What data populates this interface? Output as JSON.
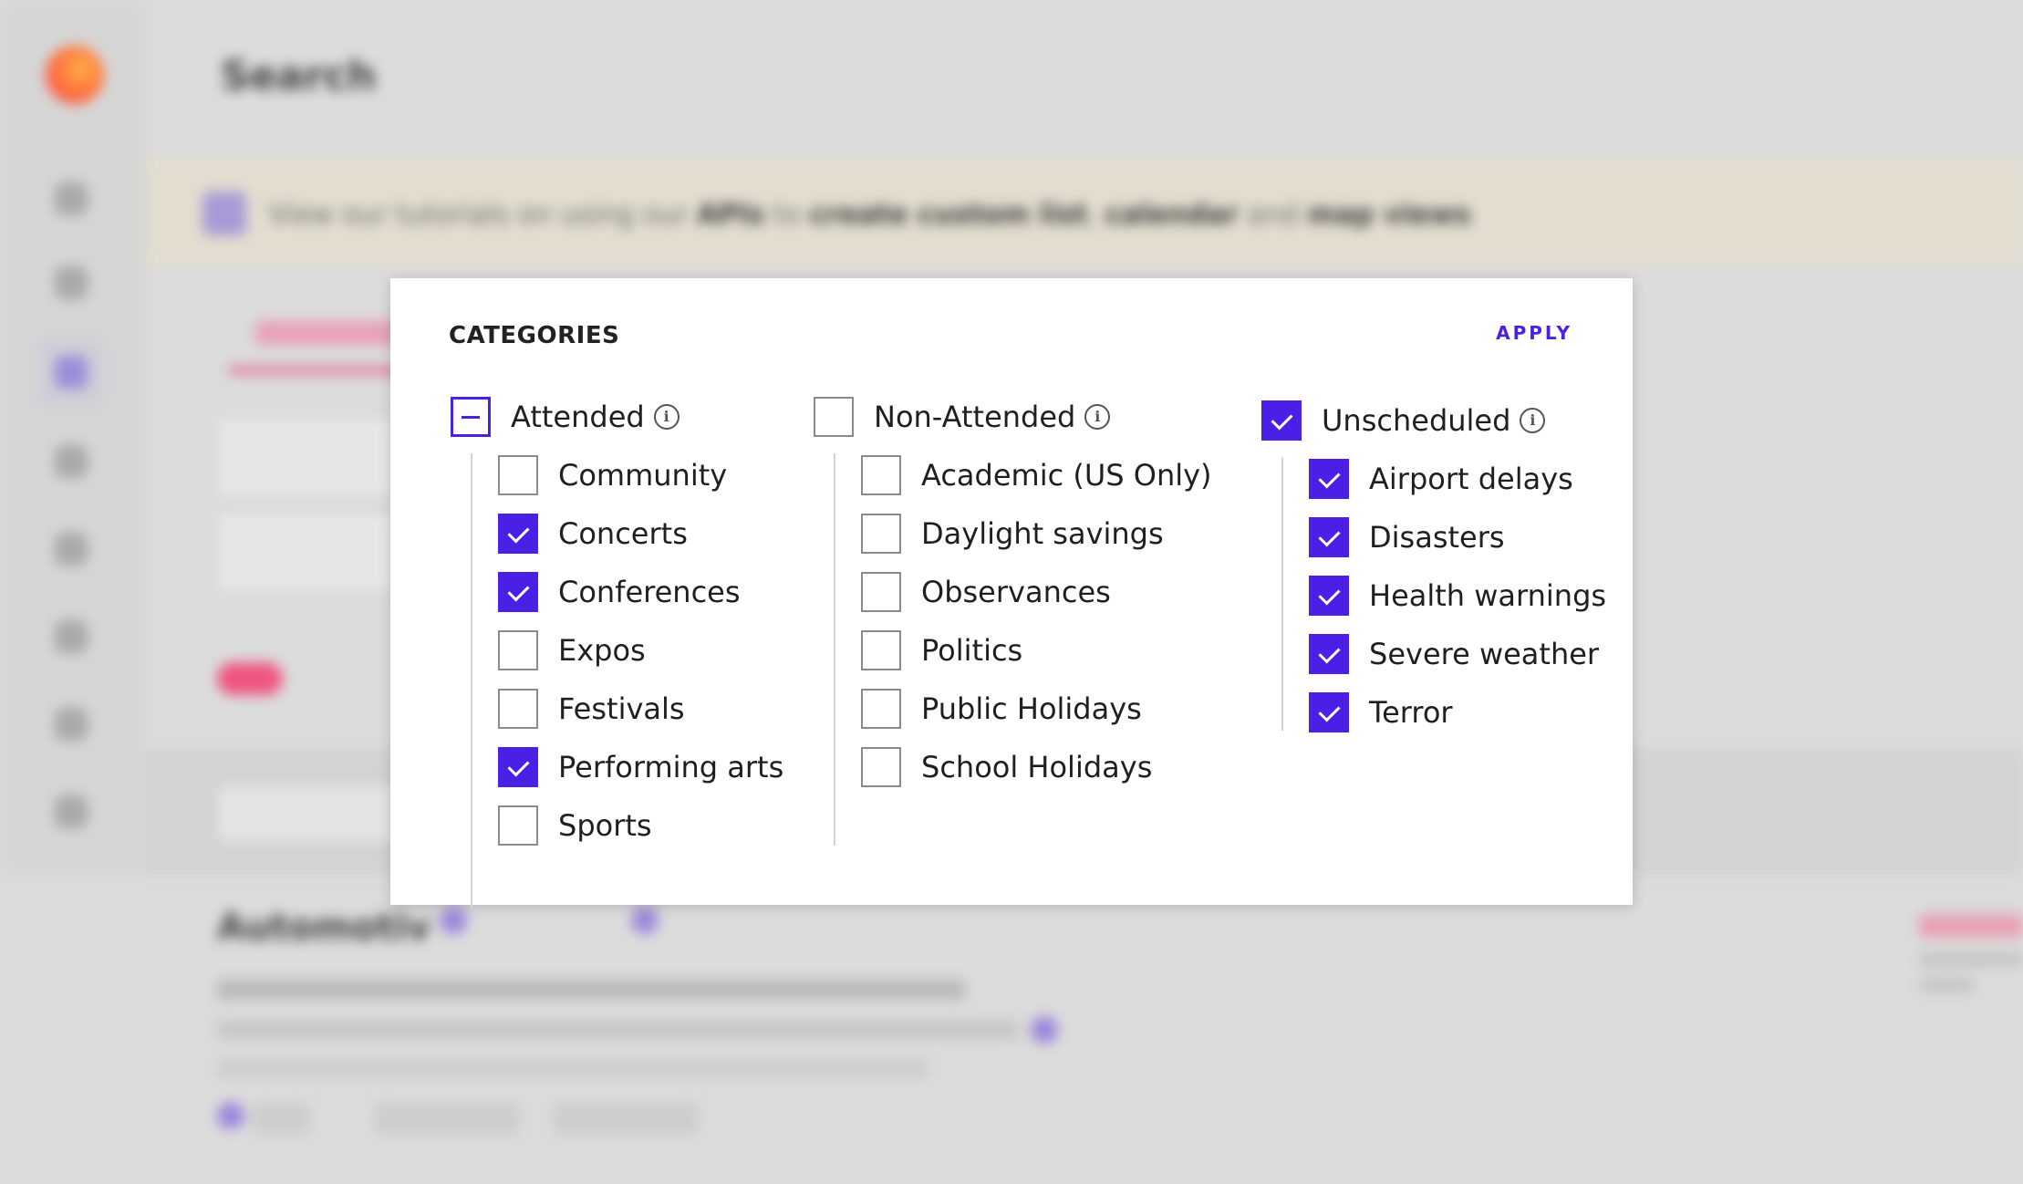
{
  "background": {
    "page_title": "Search",
    "banner": {
      "prefix": "View our tutorials on using our ",
      "apis": "APIs",
      "to": " to ",
      "create": "create custom list",
      "comma": ", ",
      "calendar": "calendar",
      "and": " and ",
      "map": "map views"
    },
    "heading": "Automotiv"
  },
  "modal": {
    "title": "CATEGORIES",
    "apply_label": "APPLY",
    "accent_color": "#4b1fe6",
    "groups": [
      {
        "label": "Attended",
        "state": "partial",
        "items": [
          {
            "label": "Community",
            "checked": false
          },
          {
            "label": "Concerts",
            "checked": true
          },
          {
            "label": "Conferences",
            "checked": true
          },
          {
            "label": "Expos",
            "checked": false
          },
          {
            "label": "Festivals",
            "checked": false
          },
          {
            "label": "Performing arts",
            "checked": true
          },
          {
            "label": "Sports",
            "checked": false
          }
        ]
      },
      {
        "label": "Non-Attended",
        "state": "unchecked",
        "items": [
          {
            "label": "Academic (US Only)",
            "checked": false
          },
          {
            "label": "Daylight savings",
            "checked": false
          },
          {
            "label": "Observances",
            "checked": false
          },
          {
            "label": "Politics",
            "checked": false
          },
          {
            "label": "Public Holidays",
            "checked": false
          },
          {
            "label": "School Holidays",
            "checked": false
          }
        ]
      },
      {
        "label": "Unscheduled",
        "state": "checked",
        "items": [
          {
            "label": "Airport delays",
            "checked": true
          },
          {
            "label": "Disasters",
            "checked": true
          },
          {
            "label": "Health warnings",
            "checked": true
          },
          {
            "label": "Severe weather",
            "checked": true
          },
          {
            "label": "Terror",
            "checked": true
          }
        ]
      }
    ]
  }
}
